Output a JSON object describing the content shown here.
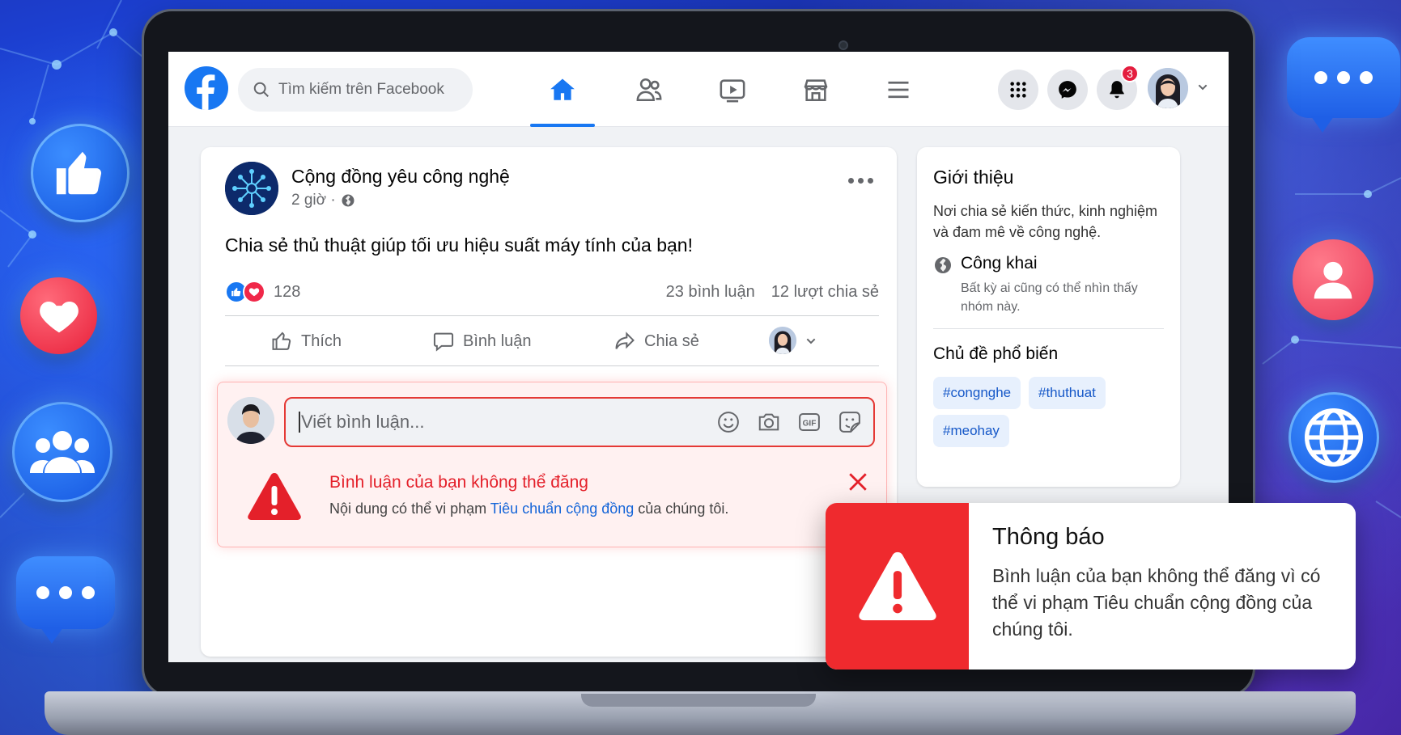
{
  "header": {
    "search_placeholder": "Tìm kiếm trên Facebook",
    "notification_count": "3"
  },
  "post": {
    "page_name": "Cộng đồng yêu công nghệ",
    "time": "2 giờ ·",
    "text": "Chia sẻ thủ thuật giúp tối ưu hiệu suất máy tính của bạn!",
    "reaction_count": "128",
    "comments": "23 bình luận",
    "shares": "12 lượt chia sẻ",
    "actions": {
      "like": "Thích",
      "comment": "Bình luận",
      "share": "Chia sẻ"
    }
  },
  "comment_box": {
    "placeholder": "Viết bình luận...",
    "error_title": "Bình luận của bạn không thể đăng",
    "error_prefix": "Nội dung có thể vi phạm ",
    "error_link": "Tiêu chuẩn cộng đồng",
    "error_suffix": " của chúng tôi.",
    "gif_label": "GIF"
  },
  "about": {
    "title": "Giới thiệu",
    "description": "Nơi chia sẻ kiến thức, kinh nghiệm và đam mê về công nghệ.",
    "privacy_title": "Công khai",
    "privacy_desc": "Bất kỳ ai cũng có thể nhìn thấy nhóm này.",
    "topics_title": "Chủ đề phổ biến",
    "tags": [
      "#congnghe",
      "#thuthuat",
      "#meohay"
    ]
  },
  "notice": {
    "title": "Thông báo",
    "message": "Bình luận của bạn không thể đăng vì có thể vi phạm Tiêu chuẩn cộng đồng của chúng tôi."
  },
  "colors": {
    "facebook_blue": "#1877f2",
    "error_red": "#e4202a",
    "notice_red": "#ef2a2e"
  }
}
